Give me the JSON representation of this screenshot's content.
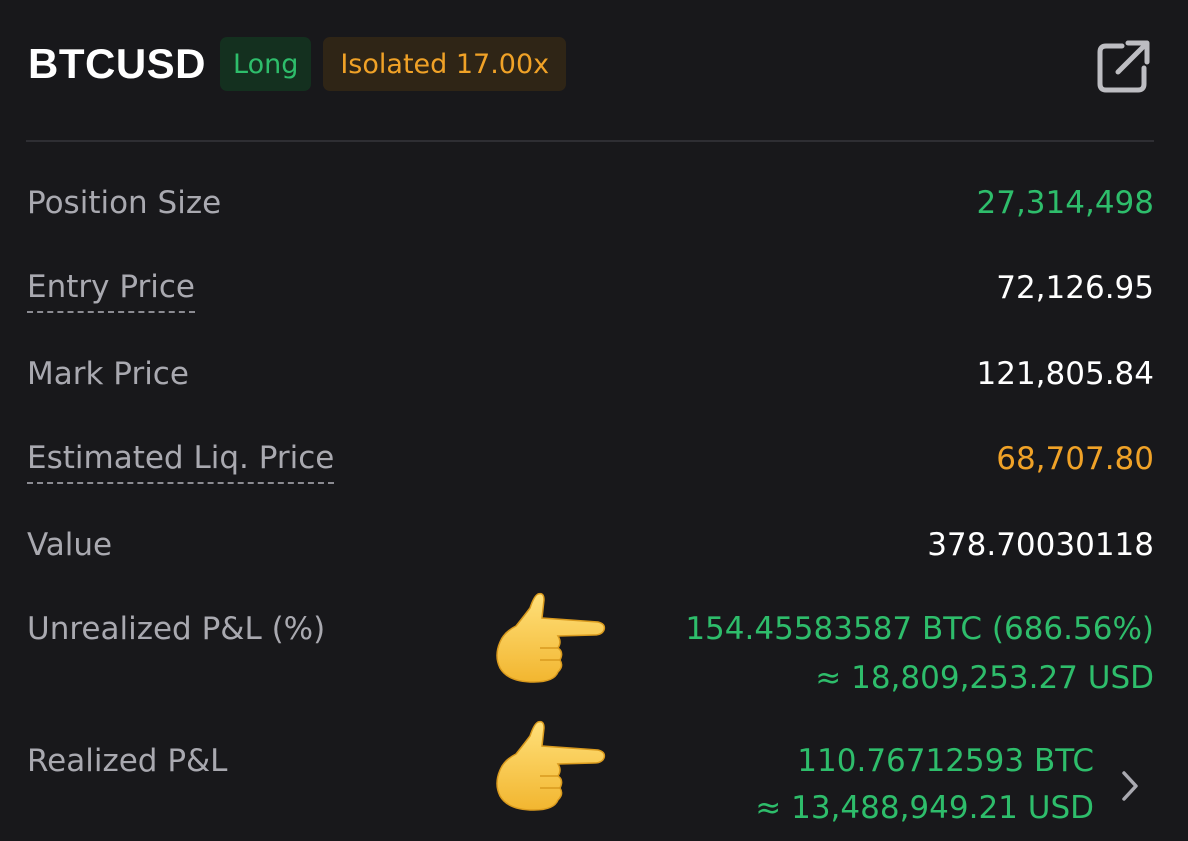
{
  "header": {
    "symbol": "BTCUSD",
    "side_badge": "Long",
    "margin_badge": "Isolated 17.00x",
    "share_icon": "external-link-icon"
  },
  "rows": {
    "position_size": {
      "label": "Position Size",
      "value": "27,314,498"
    },
    "entry_price": {
      "label": "Entry Price",
      "value": "72,126.95"
    },
    "mark_price": {
      "label": "Mark Price",
      "value": "121,805.84"
    },
    "liq_price": {
      "label": "Estimated Liq. Price",
      "value": "68,707.80"
    },
    "value": {
      "label": "Value",
      "value": "378.70030118"
    },
    "unrealized_pnl": {
      "label": "Unrealized P&L (%)",
      "value_line1": "154.45583587 BTC (686.56%)",
      "value_line2": "≈ 18,809,253.27 USD",
      "emoji": "pointing-right-hand-emoji"
    },
    "realized_pnl": {
      "label": "Realized P&L",
      "value_line1": "110.76712593 BTC",
      "value_line2": "≈ 13,488,949.21 USD",
      "emoji": "pointing-right-hand-emoji",
      "chevron": "chevron-right-icon"
    }
  },
  "colors": {
    "background": "#18181b",
    "green": "#2ebd6b",
    "orange": "#f0a227",
    "label_gray": "#a9a9b0"
  }
}
